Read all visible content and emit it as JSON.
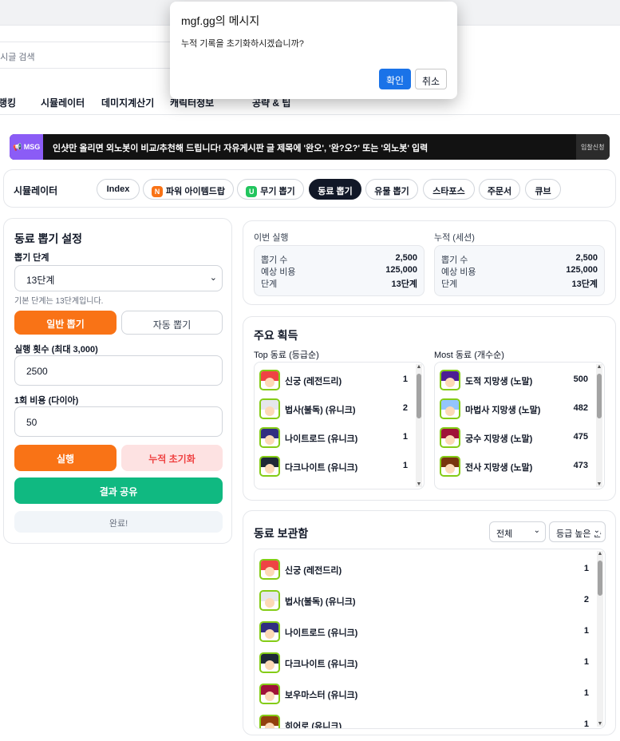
{
  "header": {
    "search_placeholder": "게시글 검색",
    "nav": [
      "랭킹",
      "시뮬레이터",
      "데미지계산기",
      "캐릭터정보",
      "공략 & 팁"
    ]
  },
  "banner": {
    "tag": "MSG",
    "text": "인샷만 올리면 외노봇이 비교/추천해 드립니다! 자유게시판 글 제목에 '완오', '완?오?' 또는 '외노봇' 입력",
    "apply": "입찰신청"
  },
  "subnav": {
    "title": "시뮬레이터",
    "tabs": [
      {
        "label": "Index"
      },
      {
        "label": "파워 아이템드랍",
        "badge": "N",
        "badge_color": "#f97316"
      },
      {
        "label": "무기 뽑기",
        "badge": "U",
        "badge_color": "#22c55e"
      },
      {
        "label": "동료 뽑기",
        "active": true
      },
      {
        "label": "유물 뽑기"
      },
      {
        "label": "스타포스"
      },
      {
        "label": "주문서"
      },
      {
        "label": "큐브"
      }
    ]
  },
  "settings": {
    "title": "동료 뽑기 설정",
    "stage_label": "뽑기 단계",
    "stage_value": "13단계",
    "stage_hint": "기본 단계는 13단계입니다.",
    "mode_normal": "일반 뽑기",
    "mode_auto": "자동 뽑기",
    "count_label": "실행 횟수 (최대 3,000)",
    "count_value": "2500",
    "cost_label": "1회 비용 (다이아)",
    "cost_value": "50",
    "run": "실행",
    "reset": "누적 초기화",
    "share": "결과 공유",
    "status": "완료!"
  },
  "stats": {
    "current_title": "이번 실행",
    "total_title": "누적 (세션)",
    "current": [
      {
        "label": "뽑기 수",
        "value": "2,500"
      },
      {
        "label": "예상 비용",
        "value": "125,000"
      },
      {
        "label": "단계",
        "value": "13단계"
      }
    ],
    "total": [
      {
        "label": "뽑기 수",
        "value": "2,500"
      },
      {
        "label": "예상 비용",
        "value": "125,000"
      },
      {
        "label": "단계",
        "value": "13단계"
      }
    ]
  },
  "gains": {
    "title": "주요 획득",
    "top_title": "Top 동료 (등급순)",
    "most_title": "Most 동료 (개수순)",
    "top": [
      {
        "name": "신궁 (레전드리)",
        "count": "1",
        "hair": "#ef4444"
      },
      {
        "name": "법사(불독) (유니크)",
        "count": "2",
        "hair": "#e5e7eb"
      },
      {
        "name": "나이트로드 (유니크)",
        "count": "1",
        "hair": "#312e81"
      },
      {
        "name": "다크나이트 (유니크)",
        "count": "1",
        "hair": "#1f2937"
      }
    ],
    "most": [
      {
        "name": "도적 지망생 (노말)",
        "count": "500",
        "hair": "#4c1d95"
      },
      {
        "name": "마법사 지망생 (노말)",
        "count": "482",
        "hair": "#93c5fd"
      },
      {
        "name": "궁수 지망생 (노말)",
        "count": "475",
        "hair": "#9f1239"
      },
      {
        "name": "전사 지망생 (노말)",
        "count": "473",
        "hair": "#78350f"
      }
    ]
  },
  "storage": {
    "title": "동료 보관함",
    "filter": "전체",
    "sort": "등급 높은 순",
    "items": [
      {
        "name": "신궁 (레전드리)",
        "count": "1",
        "hair": "#ef4444"
      },
      {
        "name": "법사(불독) (유니크)",
        "count": "2",
        "hair": "#e5e7eb"
      },
      {
        "name": "나이트로드 (유니크)",
        "count": "1",
        "hair": "#312e81"
      },
      {
        "name": "다크나이트 (유니크)",
        "count": "1",
        "hair": "#1f2937"
      },
      {
        "name": "보우마스터 (유니크)",
        "count": "1",
        "hair": "#9f1239"
      },
      {
        "name": "히어로 (유니크)",
        "count": "1",
        "hair": "#92400e"
      }
    ]
  },
  "dialog": {
    "title": "mgf.gg의 메시지",
    "message": "누적 기록을 초기화하시겠습니까?",
    "ok": "확인",
    "cancel": "취소"
  }
}
